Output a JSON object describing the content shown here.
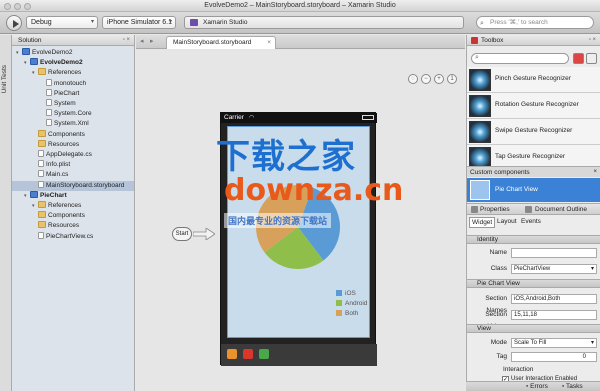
{
  "window": {
    "title": "EvolveDemo2 – MainStoryboard.storyboard – Xamarin Studio"
  },
  "toolbar": {
    "config": "Debug",
    "device": "iPhone Simulator 6.1",
    "status": "Xamarin Studio",
    "search_placeholder": "Press '⌘,' to search"
  },
  "leftstrip": {
    "label": "Unit Tests"
  },
  "solution": {
    "header": "Solution",
    "items": [
      {
        "label": "EvolveDemo2",
        "kind": "sol",
        "indent": 0
      },
      {
        "label": "EvolveDemo2",
        "kind": "proj",
        "indent": 1
      },
      {
        "label": "References",
        "kind": "folder",
        "indent": 2
      },
      {
        "label": "monotouch",
        "kind": "ref",
        "indent": 3
      },
      {
        "label": "PieChart",
        "kind": "ref",
        "indent": 3
      },
      {
        "label": "System",
        "kind": "ref",
        "indent": 3
      },
      {
        "label": "System.Core",
        "kind": "ref",
        "indent": 3
      },
      {
        "label": "System.Xml",
        "kind": "ref",
        "indent": 3
      },
      {
        "label": "Components",
        "kind": "folder",
        "indent": 2
      },
      {
        "label": "Resources",
        "kind": "folder",
        "indent": 2
      },
      {
        "label": "AppDelegate.cs",
        "kind": "file",
        "indent": 2
      },
      {
        "label": "Info.plist",
        "kind": "file",
        "indent": 2
      },
      {
        "label": "Main.cs",
        "kind": "file",
        "indent": 2
      },
      {
        "label": "MainStoryboard.storyboard",
        "kind": "file",
        "indent": 2,
        "selected": true
      },
      {
        "label": "PieChart",
        "kind": "proj",
        "indent": 1
      },
      {
        "label": "References",
        "kind": "folder",
        "indent": 2
      },
      {
        "label": "Components",
        "kind": "folder",
        "indent": 2
      },
      {
        "label": "Resources",
        "kind": "folder",
        "indent": 2
      },
      {
        "label": "PieChartView.cs",
        "kind": "file",
        "indent": 2
      }
    ]
  },
  "editor": {
    "tab": "MainStoryboard.storyboard",
    "carrier": "Carrier",
    "start": "Start",
    "zoom_icons": [
      "zoom-fit-icon",
      "zoom-out-icon",
      "zoom-in-icon",
      "zoom-actual-icon"
    ]
  },
  "chart_data": {
    "type": "pie",
    "categories": [
      "iOS",
      "Android",
      "Both"
    ],
    "values": [
      15,
      11,
      18
    ],
    "colors": [
      "#5b9bd5",
      "#8fbf4a",
      "#d7a15b"
    ]
  },
  "watermark": {
    "line1": "下载之家",
    "line2": "downza.cn",
    "line3": "国内最专业的资源下载站"
  },
  "toolbox": {
    "header": "Toolbox",
    "items": [
      "Pinch Gesture Recognizer",
      "Rotation Gesture Recognizer",
      "Swipe Gesture Recognizer",
      "Tap Gesture Recognizer"
    ],
    "custom_header": "Custom components",
    "custom_item": "Pie Chart View"
  },
  "properties": {
    "tab_properties": "Properties",
    "tab_outline": "Document Outline",
    "subtabs": [
      "Widget",
      "Layout",
      "Events"
    ],
    "identity_header": "Identity",
    "name_label": "Name",
    "name_value": "",
    "class_label": "Class",
    "class_value": "PieChartView",
    "piechart_header": "Pie Chart View",
    "section_names_label": "Section Names",
    "section_names_value": "iOS,Android,Both",
    "section_values_label": "Section Values",
    "section_values_value": "15,11,18",
    "view_header": "View",
    "mode_label": "Mode",
    "mode_value": "Scale To Fill",
    "tag_label": "Tag",
    "tag_value": "0",
    "interaction_label": "Interaction",
    "user_interaction": "User Interaction Enabled"
  },
  "bottom": {
    "errors": "Errors",
    "tasks": "Tasks"
  }
}
